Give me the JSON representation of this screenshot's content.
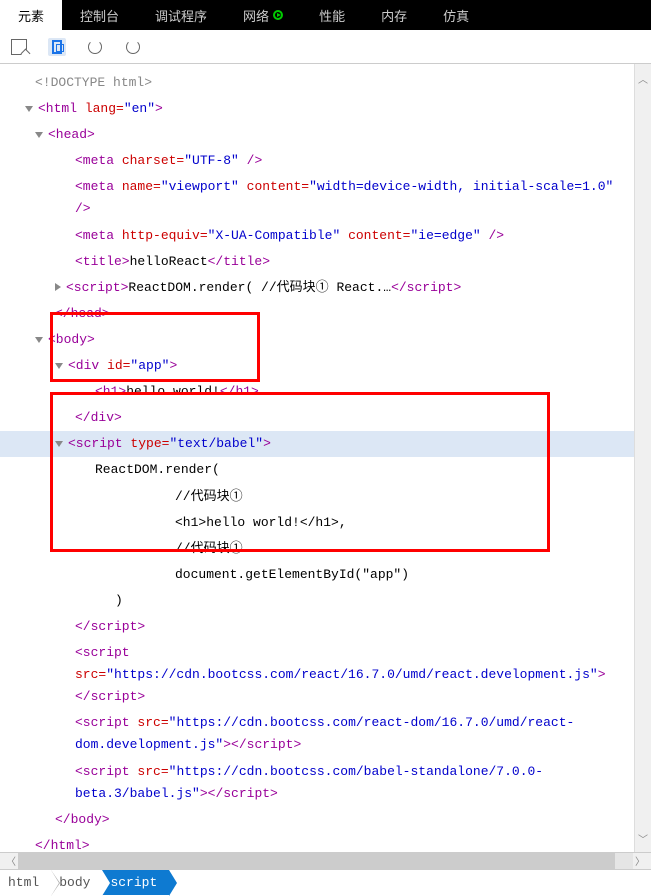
{
  "tabs": {
    "elements": "元素",
    "console": "控制台",
    "debugger": "调试程序",
    "network": "网络",
    "performance": "性能",
    "memory": "内存",
    "emulation": "仿真"
  },
  "dom": {
    "doctype": "<!DOCTYPE html>",
    "html_open": "<html lang=\"en\">",
    "head_open": "<head>",
    "meta1_pre": "<meta ",
    "meta1_attr": "charset=",
    "meta1_val": "\"UTF-8\"",
    "meta1_end": " />",
    "meta2_pre": "<meta ",
    "meta2_name": "name=",
    "meta2_nameval": "\"viewport\"",
    "meta2_content": " content=",
    "meta2_contentval": "\"width=device-width, initial-scale=1.0\"",
    "meta2_end": " />",
    "meta3_pre": "<meta ",
    "meta3_httpeq": "http-equiv=",
    "meta3_httpeqval": "\"X-UA-Compatible\"",
    "meta3_content": " content=",
    "meta3_contentval": "\"ie=edge\"",
    "meta3_end": " />",
    "title_open": "<title>",
    "title_text": "helloReact",
    "title_close": "</title>",
    "script1_open": "<script>",
    "script1_text": "ReactDOM.render( //代码块① React.…",
    "script1_close": "</script>",
    "head_close": "</head>",
    "body_open": "<body>",
    "div_open_pre": "<div ",
    "div_attr": "id=",
    "div_val": "\"app\"",
    "div_open_end": ">",
    "h1_open": "<h1>",
    "h1_text": "hello world!",
    "h1_close": "</h1>",
    "div_close": "</div>",
    "script2_open_pre": "<script ",
    "script2_type": "type=",
    "script2_typeval": "\"text/babel\"",
    "script2_open_end": ">",
    "react_l1": "ReactDOM.render(",
    "react_l2": "//代码块①",
    "react_l3": "<h1>hello world!</h1>,",
    "react_l4": "//代码块①",
    "react_l5": "document.getElementById(\"app\")",
    "react_l6": ")",
    "script2_close": "</script>",
    "script3_open": "<script ",
    "script3_src": "src=",
    "script3_srcval": "\"https://cdn.bootcss.com/react/16.7.0/umd/react.development.js\"",
    "script3_mid": ">",
    "script3_close": "</script>",
    "script4_open": "<script ",
    "script4_src": "src=",
    "script4_srcval": "\"https://cdn.bootcss.com/react-dom/16.7.0/umd/react-dom.development.js\"",
    "script4_mid": ">",
    "script4_close": "</script>",
    "script5_open": "<script ",
    "script5_src": "src=",
    "script5_srcval": "\"https://cdn.bootcss.com/babel-standalone/7.0.0-beta.3/babel.js\"",
    "script5_mid": ">",
    "script5_close": "</script>",
    "body_close": "</body>",
    "html_close": "</html>"
  },
  "breadcrumb": {
    "html": "html",
    "body": "body",
    "script": "script"
  }
}
